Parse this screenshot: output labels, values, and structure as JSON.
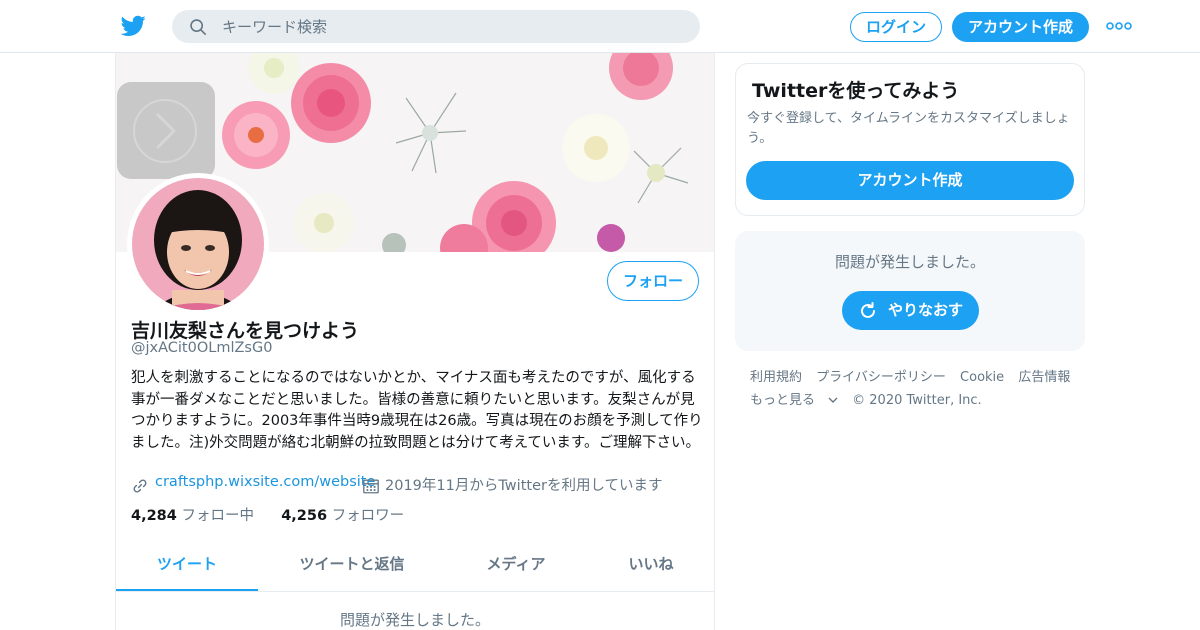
{
  "topbar": {
    "search_placeholder": "キーワード検索",
    "login_label": "ログイン",
    "signup_label": "アカウント作成"
  },
  "profile": {
    "display_name": "吉川友梨さんを見つけよう",
    "handle": "@jxACit0OLmlZsG0",
    "follow_label": "フォロー",
    "bio": "犯人を刺激することになるのではないかとか、マイナス面も考えたのですが、風化する事が一番ダメなことだと思いました。皆様の善意に頼りたいと思います。友梨さんが見つかりますように。2003年事件当時9歳現在は26歳。写真は現在のお顔を予測して作りました。注)外交問題が絡む北朝鮮の拉致問題とは分けて考えています。ご理解下さい。",
    "website": "craftsphp.wixsite.com/website",
    "joined": "2019年11月からTwitterを利用しています",
    "following_count": "4,284",
    "following_label": "フォロー中",
    "followers_count": "4,256",
    "followers_label": "フォロワー",
    "tabs": [
      {
        "label": "ツイート"
      },
      {
        "label": "ツイートと返信"
      },
      {
        "label": "メディア"
      },
      {
        "label": "いいね"
      }
    ],
    "timeline_error": "問題が発生しました。"
  },
  "sidebar": {
    "signup_card": {
      "title": "Twitterを使ってみよう",
      "description": "今すぐ登録して、タイムラインをカスタマイズしましょう。",
      "button_label": "アカウント作成"
    },
    "error_card": {
      "message": "問題が発生しました。",
      "retry_label": "やりなおす"
    },
    "footer": {
      "terms": "利用規約",
      "privacy": "プライバシーポリシー",
      "cookie": "Cookie",
      "ads": "広告情報",
      "more": "もっと見る",
      "copyright": "© 2020 Twitter, Inc."
    }
  },
  "colors": {
    "accent": "#1da1f2",
    "link": "#1b95e0",
    "secondary_text": "#657786",
    "border": "#e6ecf0"
  },
  "icons": [
    "twitter-bird-icon",
    "search-icon",
    "more-dots-icon",
    "chevron-right-icon",
    "link-icon",
    "calendar-icon",
    "refresh-icon",
    "chevron-down-icon"
  ]
}
